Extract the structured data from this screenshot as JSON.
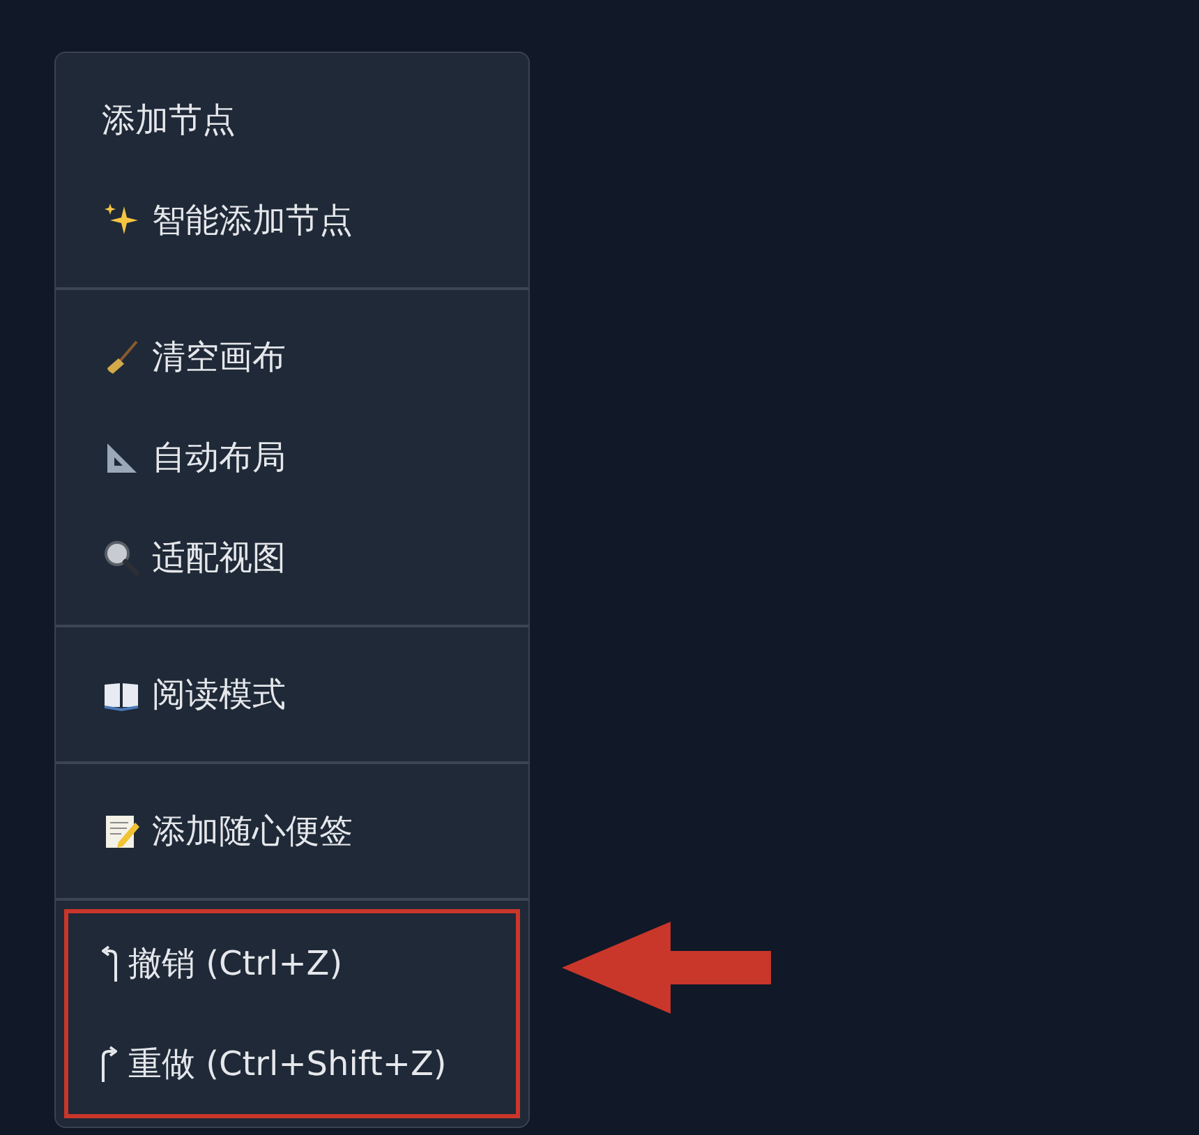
{
  "menu": {
    "groups": [
      {
        "highlighted": false,
        "items": [
          {
            "label": "添加节点"
          },
          {
            "label": "智能添加节点"
          }
        ]
      },
      {
        "highlighted": false,
        "items": [
          {
            "label": "清空画布"
          },
          {
            "label": "自动布局"
          },
          {
            "label": "适配视图"
          }
        ]
      },
      {
        "highlighted": false,
        "items": [
          {
            "label": "阅读模式"
          }
        ]
      },
      {
        "highlighted": false,
        "items": [
          {
            "label": "添加随心便签"
          }
        ]
      },
      {
        "highlighted": true,
        "items": [
          {
            "label": "撤销 (Ctrl+Z)"
          },
          {
            "label": "重做 (Ctrl+Shift+Z)"
          }
        ]
      }
    ]
  },
  "annotation_arrow": {
    "color": "#c9362a"
  }
}
